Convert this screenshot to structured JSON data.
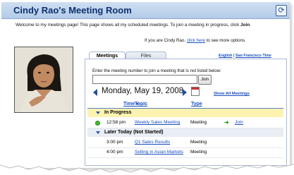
{
  "header": {
    "title": "Cindy Rao's Meeting Room",
    "refresh_icon": "refresh-icon"
  },
  "welcome": {
    "text_before": "Welcome to my meetings page! This page shows all my scheduled meetings. To join a meeting in progress, click ",
    "bold": "Join",
    "text_after": "."
  },
  "identity": {
    "prefix": "If you are Cindy Rao, ",
    "link": "click here",
    "suffix": " to see more options."
  },
  "tabs": [
    {
      "label": "Meetings"
    },
    {
      "label": "Files"
    }
  ],
  "locale": {
    "language": "English",
    "separator": " | ",
    "timezone": "San Francisco Time"
  },
  "join_form": {
    "label": "Enter the meeting number to join a meeting that is not listed below:",
    "input_value": "",
    "button_label": "Join"
  },
  "date_nav": {
    "date": "Monday, May 19, 2008",
    "show_all": "Show All Meetings"
  },
  "columns": {
    "time": "Time",
    "topic": "Topic",
    "type": "Type"
  },
  "groups": [
    {
      "label": "In Progress",
      "rows": [
        {
          "time": "12:58 pm",
          "topic": "Weekly Sales Meeting",
          "type": "Meeting",
          "action": "Join"
        }
      ]
    },
    {
      "label": "Later Today (Not Started)",
      "rows": [
        {
          "time": "3:00 pm",
          "topic": "Q1 Sales Results",
          "type": "Meeting"
        },
        {
          "time": "4:00 pm",
          "topic": "Selling in Asian Markets",
          "type": "Meeting"
        }
      ]
    }
  ],
  "colors": {
    "header_bg": "#b3cbe8",
    "title": "#0d2f6e",
    "link": "#1a4fc0",
    "in_progress_bg": "#fdf3b0",
    "later_bg": "#e9edf4"
  }
}
